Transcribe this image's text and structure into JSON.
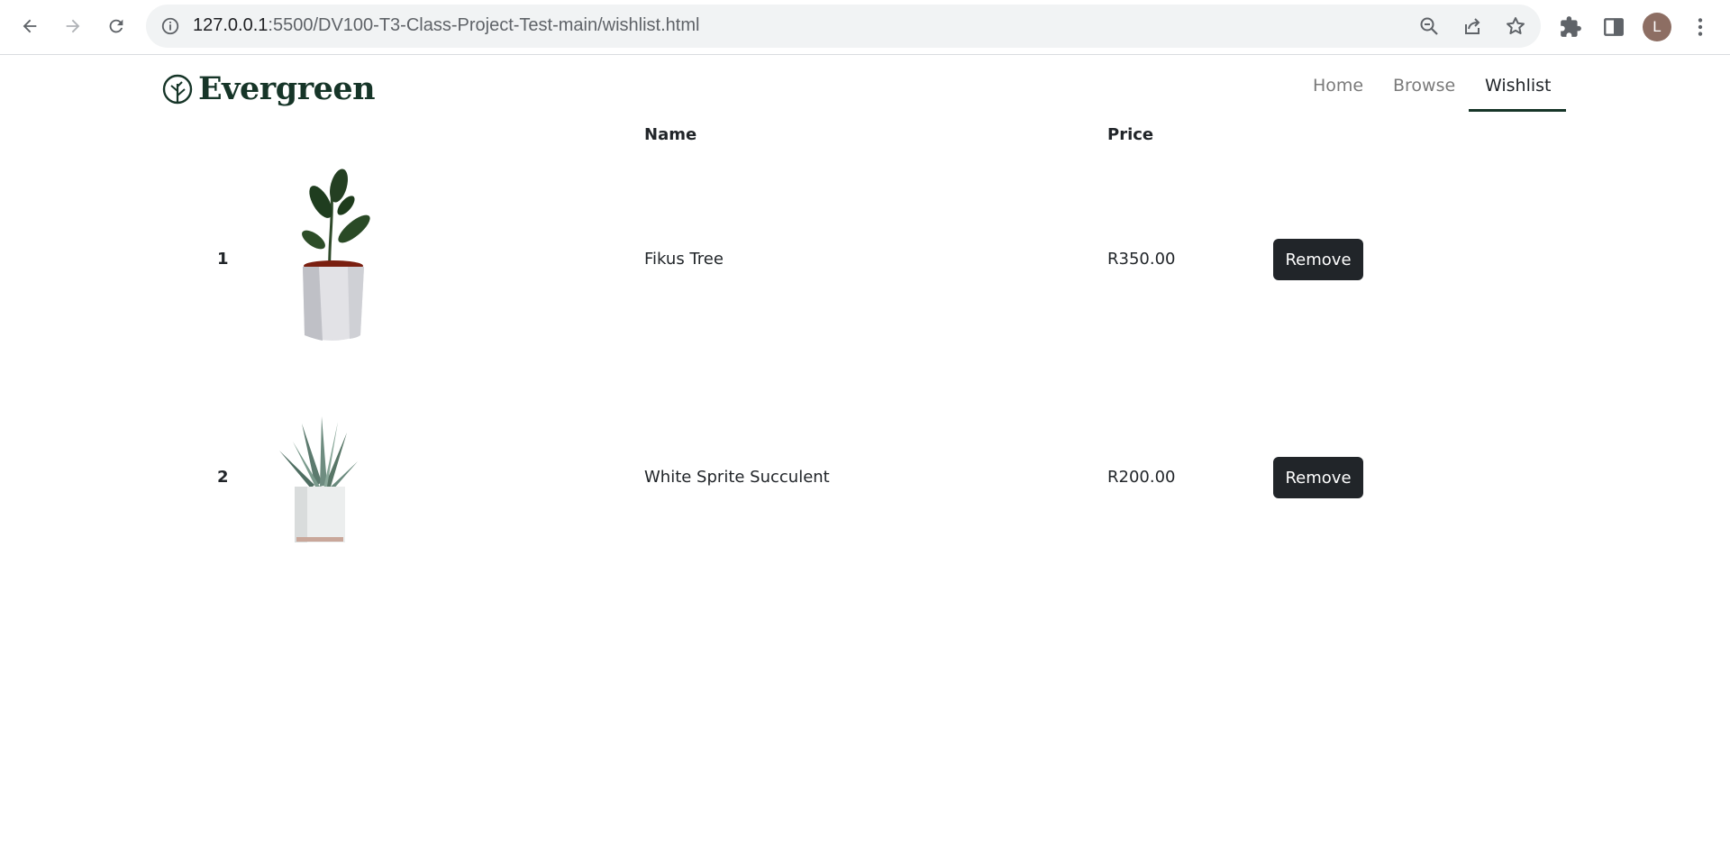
{
  "browser": {
    "url_host": "127.0.0.1",
    "url_rest": ":5500/DV100-T3-Class-Project-Test-main/wishlist.html",
    "profile_initial": "L"
  },
  "header": {
    "brand": "Evergreen",
    "nav": [
      {
        "label": "Home",
        "active": false
      },
      {
        "label": "Browse",
        "active": false
      },
      {
        "label": "Wishlist",
        "active": true
      }
    ]
  },
  "table": {
    "columns": {
      "name": "Name",
      "price": "Price"
    },
    "rows": [
      {
        "index": "1",
        "image_icon": "ficus-plant",
        "name": "Fikus Tree",
        "price": "R350.00",
        "action": "Remove"
      },
      {
        "index": "2",
        "image_icon": "succulent-plant",
        "name": "White Sprite Succulent",
        "price": "R200.00",
        "action": "Remove"
      }
    ]
  },
  "colors": {
    "brand": "#163528",
    "button": "#212529",
    "nav_inactive": "#7a7a7a"
  }
}
